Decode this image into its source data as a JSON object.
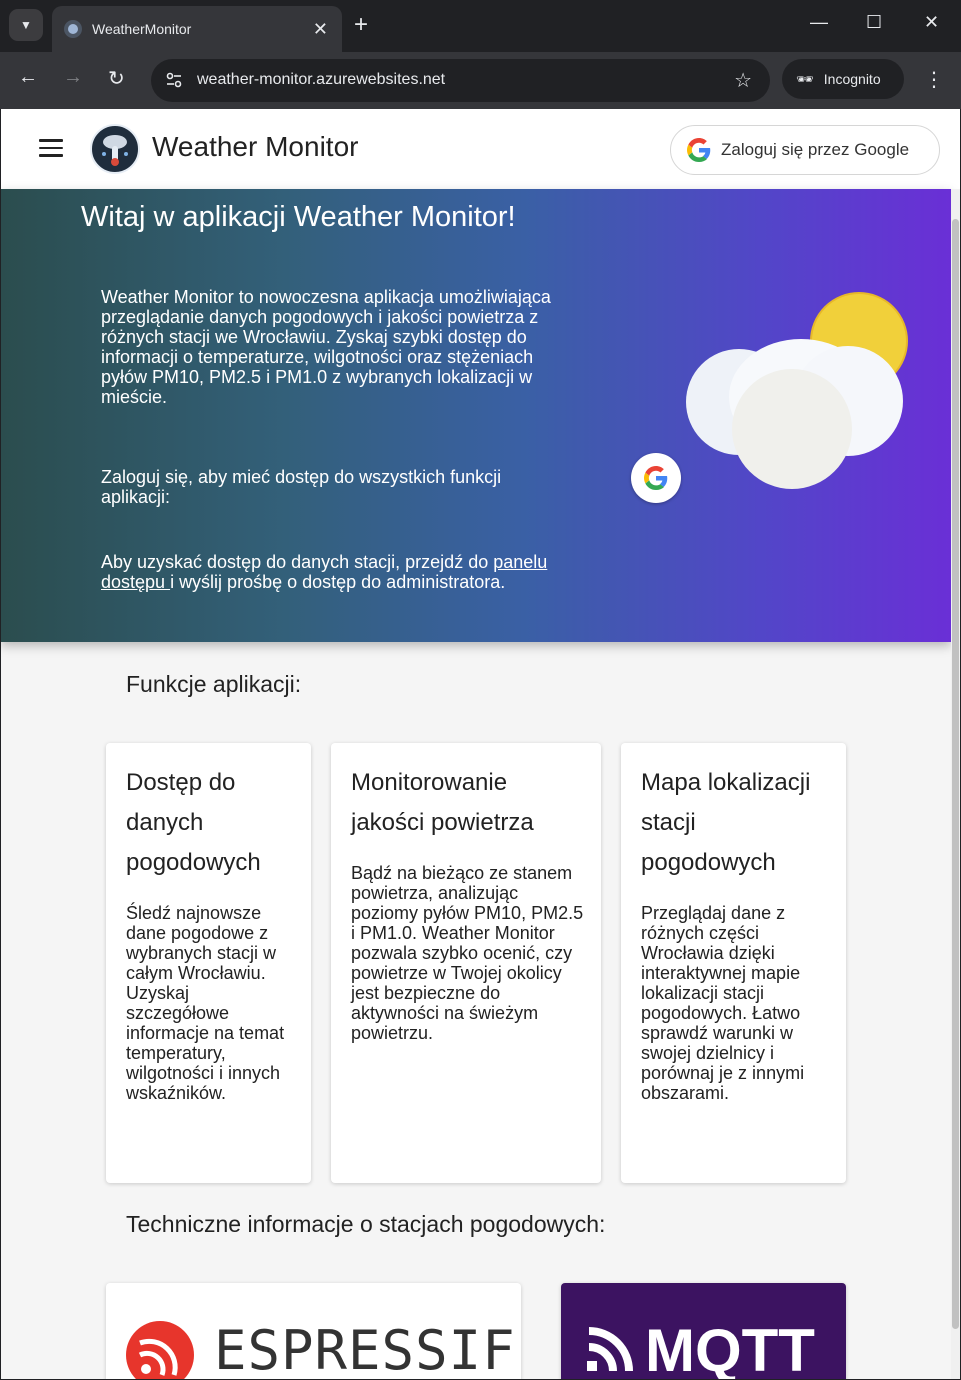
{
  "browser": {
    "tab_title": "WeatherMonitor",
    "url": "weather-monitor.azurewebsites.net",
    "incognito_label": "Incognito"
  },
  "header": {
    "brand": "Weather Monitor",
    "google_login": "Zaloguj się przez Google"
  },
  "hero": {
    "title": "Witaj w aplikacji Weather Monitor!",
    "paragraph1": "Weather Monitor to nowoczesna aplikacja umożliwiająca przeglądanie danych pogodowych i jakości powietrza z różnych stacji we Wrocławiu. Zyskaj szybki dostęp do informacji o temperaturze, wilgotności oraz stężeniach pyłów PM10, PM2.5 i PM1.0 z wybranych lokalizacji w mieście.",
    "paragraph2": "Zaloguj się, aby mieć dostęp do wszystkich funkcji aplikacji:",
    "paragraph3_before": "Aby uzyskać dostęp do danych stacji, przejdź do ",
    "paragraph3_link": "panelu dostępu ",
    "paragraph3_after": "i wyślij prośbę o dostęp do administratora."
  },
  "features": {
    "title": "Funkcje aplikacji:",
    "cards": [
      {
        "title": "Dostęp do danych pogodowych",
        "text": "Śledź najnowsze dane pogodowe z wybranych stacji w całym Wrocławiu. Uzyskaj szczegółowe informacje na temat temperatury, wilgotności i innych wskaźników."
      },
      {
        "title": "Monitorowanie jakości powietrza",
        "text": "Bądź na bieżąco ze stanem powietrza, analizując poziomy pyłów PM10, PM2.5 i PM1.0. Weather Monitor pozwala szybko ocenić, czy powietrze w Twojej okolicy jest bezpieczne do aktywności na świeżym powietrzu."
      },
      {
        "title": "Mapa lokalizacji stacji pogodowych",
        "text": "Przeglądaj dane z różnych części Wrocławia dzięki interaktywnej mapie lokalizacji stacji pogodowych. Łatwo sprawdź warunki w swojej dzielnicy i porównaj je z innymi obszarami."
      }
    ]
  },
  "tech": {
    "title": "Techniczne informacje o stacjach pogodowych:",
    "logos": [
      "ESPRESSIF",
      "MQTT"
    ]
  },
  "colors": {
    "espressif_red": "#e7352c",
    "mqtt_purple": "#3c1361"
  }
}
